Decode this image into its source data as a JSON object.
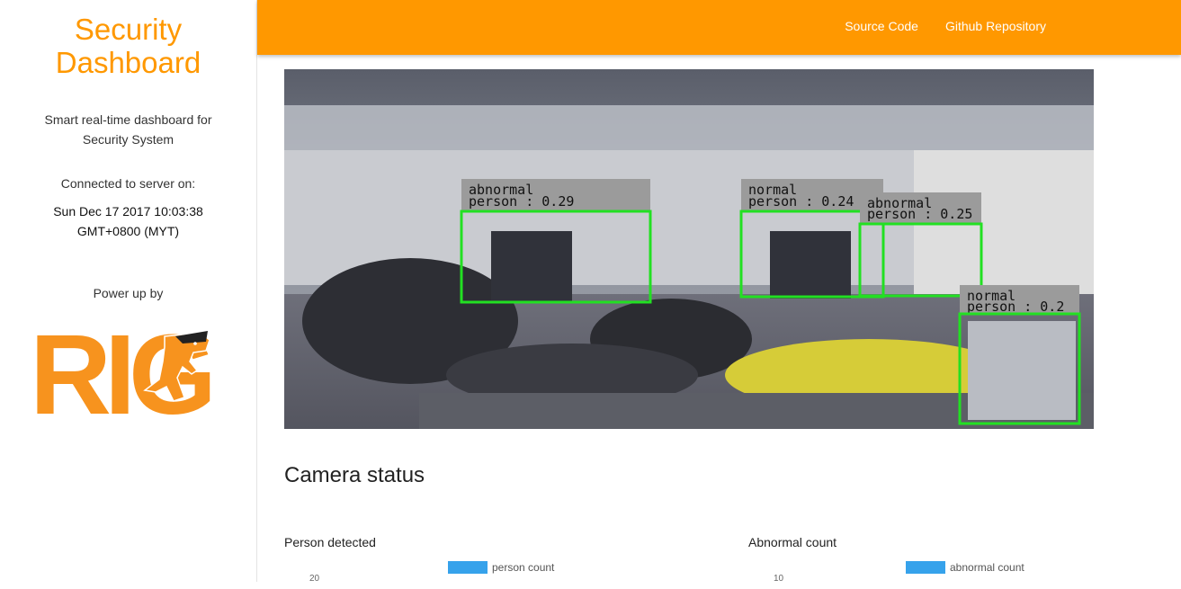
{
  "sidebar": {
    "title_line1": "Security",
    "title_line2": "Dashboard",
    "tagline_line1": "Smart real-time dashboard for",
    "tagline_line2": "Security System",
    "connected_label": "Connected to server on:",
    "server_time_line1": "Sun Dec 17 2017 10:03:38",
    "server_time_line2": "GMT+0800 (MYT)",
    "power_label": "Power up by",
    "logo_text": "RIG"
  },
  "topbar": {
    "links": [
      {
        "label": "Source Code"
      },
      {
        "label": "Github Repository"
      }
    ]
  },
  "camera": {
    "detections": [
      {
        "line1": "abnormal",
        "line2": "person : 0.29"
      },
      {
        "line1": "normal",
        "line2": "person : 0.24"
      },
      {
        "line1": "abnormal",
        "line2": "person : 0.25"
      },
      {
        "line1": "normal",
        "line2": "person : 0.2"
      }
    ]
  },
  "main": {
    "section_title": "Camera status"
  },
  "charts": [
    {
      "title": "Person detected",
      "legend": "person count",
      "top_tick": "20"
    },
    {
      "title": "Abnormal count",
      "legend": "abnormal count",
      "top_tick": "10"
    }
  ],
  "colors": {
    "accent": "#ff9800",
    "detection_box": "#22e022",
    "legend_swatch": "#36a2eb"
  }
}
